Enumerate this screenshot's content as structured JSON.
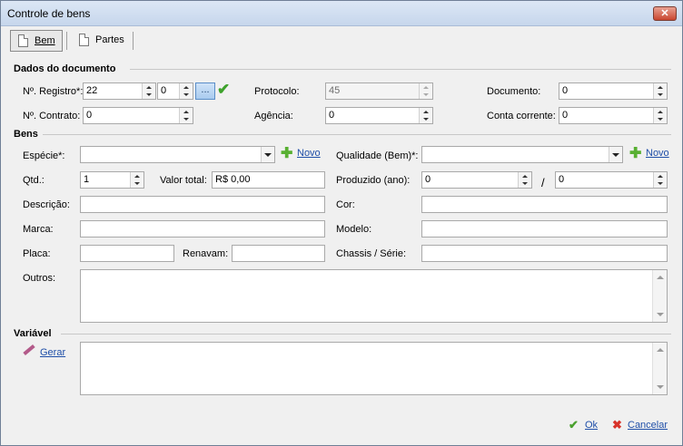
{
  "window": {
    "title": "Controle de bens",
    "close_glyph": "✕"
  },
  "tabs": [
    {
      "label": "Bem",
      "icon": "document-icon"
    },
    {
      "label": "Partes",
      "icon": "document-icon"
    }
  ],
  "documento": {
    "section_title": "Dados do documento",
    "registro_label": "Nº. Registro*:",
    "registro_value": "22",
    "registro_suffix": "0",
    "lookup_label": "...",
    "contrato_label": "Nº. Contrato:",
    "contrato_value": "0",
    "protocolo_label": "Protocolo:",
    "protocolo_value": "45",
    "agencia_label": "Agência:",
    "agencia_value": "0",
    "documento_label": "Documento:",
    "documento_value": "0",
    "conta_label": "Conta corrente:",
    "conta_value": "0"
  },
  "bens": {
    "section_title": "Bens",
    "especie_label": "Espécie*:",
    "especie_value": "",
    "novo_label": "Novo",
    "qualidade_label": "Qualidade (Bem)*:",
    "qualidade_value": "",
    "qtd_label": "Qtd.:",
    "qtd_value": "1",
    "valor_label": "Valor total:",
    "valor_value": "R$ 0,00",
    "produzido_label": "Produzido (ano):",
    "produzido_from": "0",
    "produzido_sep": "/",
    "produzido_to": "0",
    "descricao_label": "Descrição:",
    "cor_label": "Cor:",
    "marca_label": "Marca:",
    "modelo_label": "Modelo:",
    "placa_label": "Placa:",
    "renavam_label": "Renavam:",
    "chassis_label": "Chassis / Série:",
    "outros_label": "Outros:"
  },
  "variavel": {
    "section_title": "Variável",
    "gerar_label": "Gerar"
  },
  "footer": {
    "ok_label": "Ok",
    "cancel_label": "Cancelar"
  },
  "colors": {
    "link": "#1f4fa8",
    "ok": "#4aa02e",
    "cancel": "#d8332a",
    "check": "#3ea22c"
  }
}
